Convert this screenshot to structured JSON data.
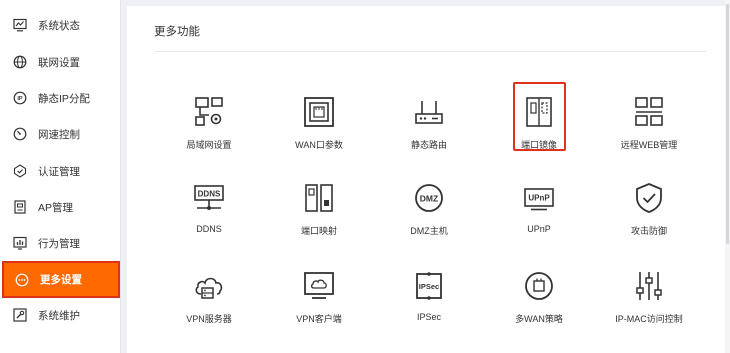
{
  "sidebar": {
    "items": [
      {
        "label": "系统状态",
        "icon": "chart-monitor-icon"
      },
      {
        "label": "联网设置",
        "icon": "globe-icon"
      },
      {
        "label": "静态IP分配",
        "icon": "ip-icon"
      },
      {
        "label": "网速控制",
        "icon": "speedometer-icon"
      },
      {
        "label": "认证管理",
        "icon": "shield-check-icon"
      },
      {
        "label": "AP管理",
        "icon": "ap-device-icon"
      },
      {
        "label": "行为管理",
        "icon": "bar-chart-icon"
      },
      {
        "label": "更多设置",
        "icon": "more-dots-icon"
      },
      {
        "label": "系统维护",
        "icon": "wrench-icon"
      }
    ],
    "active_index": 7
  },
  "main": {
    "title": "更多功能",
    "features": [
      {
        "label": "局域网设置",
        "icon": "lan-settings-icon"
      },
      {
        "label": "WAN口参数",
        "icon": "wan-port-icon"
      },
      {
        "label": "静态路由",
        "icon": "router-icon"
      },
      {
        "label": "端口镜像",
        "icon": "port-mirror-icon"
      },
      {
        "label": "远程WEB管理",
        "icon": "remote-web-icon"
      },
      {
        "label": "DDNS",
        "icon": "ddns-icon"
      },
      {
        "label": "端口映射",
        "icon": "port-mapping-icon"
      },
      {
        "label": "DMZ主机",
        "icon": "dmz-icon"
      },
      {
        "label": "UPnP",
        "icon": "upnp-icon"
      },
      {
        "label": "攻击防御",
        "icon": "shield-defense-icon"
      },
      {
        "label": "VPN服务器",
        "icon": "vpn-server-icon"
      },
      {
        "label": "VPN客户端",
        "icon": "vpn-client-icon"
      },
      {
        "label": "IPSec",
        "icon": "ipsec-icon"
      },
      {
        "label": "多WAN策略",
        "icon": "multi-wan-icon"
      },
      {
        "label": "IP-MAC访问控制",
        "icon": "ip-mac-sliders-icon"
      }
    ],
    "icon_text": {
      "ddns": "DDNS",
      "dmz": "DMZ",
      "upnp": "UPnP",
      "ipsec": "IPSec"
    }
  },
  "colors": {
    "accent": "#ff6a00",
    "highlight_border": "#e0311f",
    "icon_stroke": "#333333"
  }
}
